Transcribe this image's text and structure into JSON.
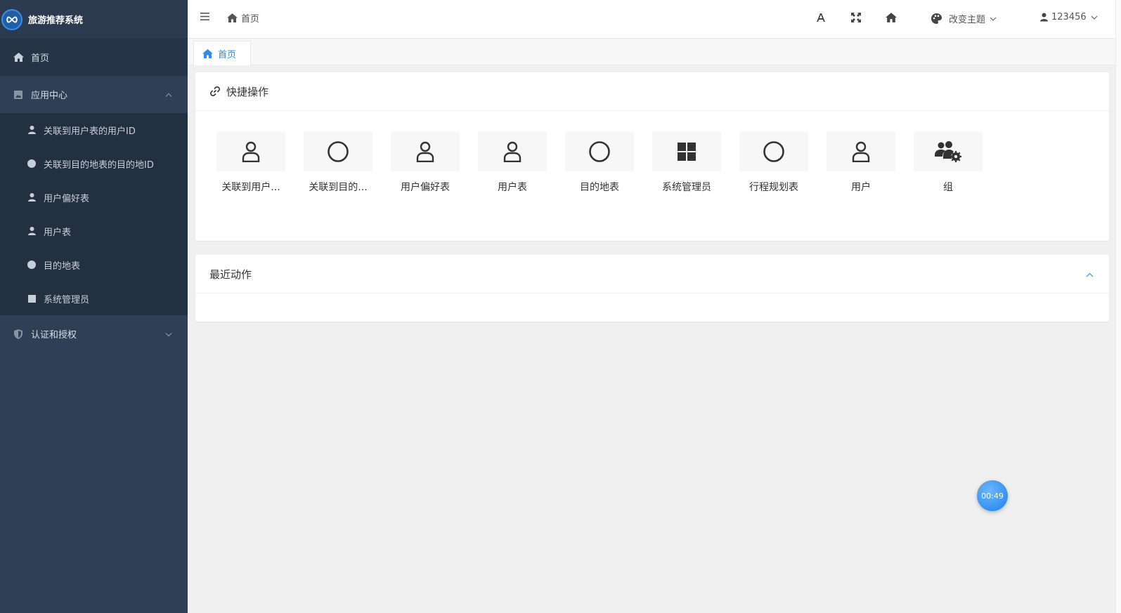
{
  "app": {
    "title": "旅游推荐系统"
  },
  "sidebar": {
    "home": "首页",
    "app_center": "应用中心",
    "sub_items": [
      {
        "label": "关联到用户表的用户ID",
        "icon": "user-icon"
      },
      {
        "label": "关联到目的地表的目的地ID",
        "icon": "circle-icon"
      },
      {
        "label": "用户偏好表",
        "icon": "user-icon"
      },
      {
        "label": "用户表",
        "icon": "user-icon"
      },
      {
        "label": "目的地表",
        "icon": "circle-icon"
      },
      {
        "label": "系统管理员",
        "icon": "square-icon"
      }
    ],
    "auth": "认证和授权"
  },
  "header": {
    "breadcrumb": "首页",
    "theme_label": "改变主题",
    "username": "123456"
  },
  "tabs": [
    {
      "label": "首页"
    }
  ],
  "quick_actions": {
    "title": "快捷操作",
    "items": [
      {
        "label": "关联到用户...",
        "icon": "user-outline-icon"
      },
      {
        "label": "关联到目的...",
        "icon": "circle-outline-icon"
      },
      {
        "label": "用户偏好表",
        "icon": "user-outline-icon"
      },
      {
        "label": "用户表",
        "icon": "user-outline-icon"
      },
      {
        "label": "目的地表",
        "icon": "circle-outline-icon"
      },
      {
        "label": "系统管理员",
        "icon": "grid-icon"
      },
      {
        "label": "行程规划表",
        "icon": "circle-outline-icon"
      },
      {
        "label": "用户",
        "icon": "user-outline-icon"
      },
      {
        "label": "组",
        "icon": "users-cog-icon"
      }
    ]
  },
  "recent_actions": {
    "title": "最近动作"
  },
  "timer": {
    "value": "00:49"
  },
  "colors": {
    "sidebar": "#2f4056",
    "accent": "#2d8cf0"
  }
}
